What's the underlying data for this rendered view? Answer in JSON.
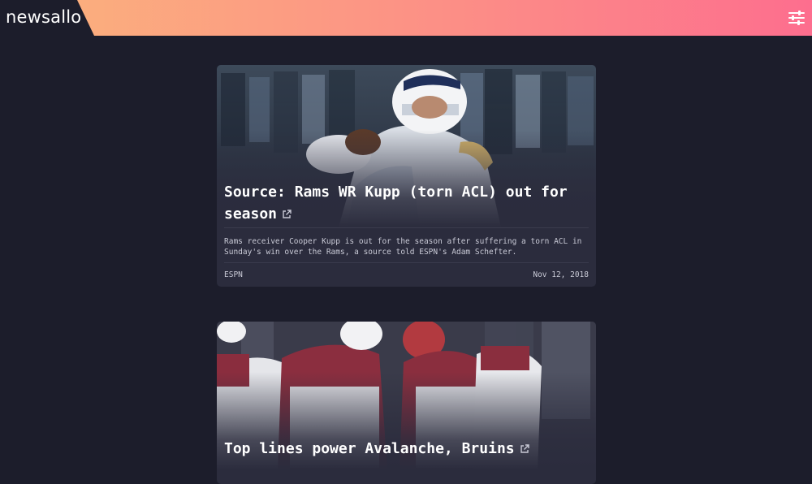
{
  "header": {
    "logo": "newsallo",
    "settings_icon": "sliders-icon",
    "gradient": [
      "#fbb47c",
      "#fd6e8e"
    ]
  },
  "articles": [
    {
      "title": "Source: Rams WR Kupp (torn ACL) out for season",
      "summary": "Rams receiver Cooper Kupp is out for the season after suffering a torn ACL in Sunday's win over the Rams, a source told ESPN's Adam Schefter.",
      "source": "ESPN",
      "date": "Nov 12, 2018"
    },
    {
      "title": "Top lines power Avalanche, Bruins"
    }
  ],
  "colors": {
    "background": "#1c1d2b",
    "card": "#2b2c3d"
  }
}
